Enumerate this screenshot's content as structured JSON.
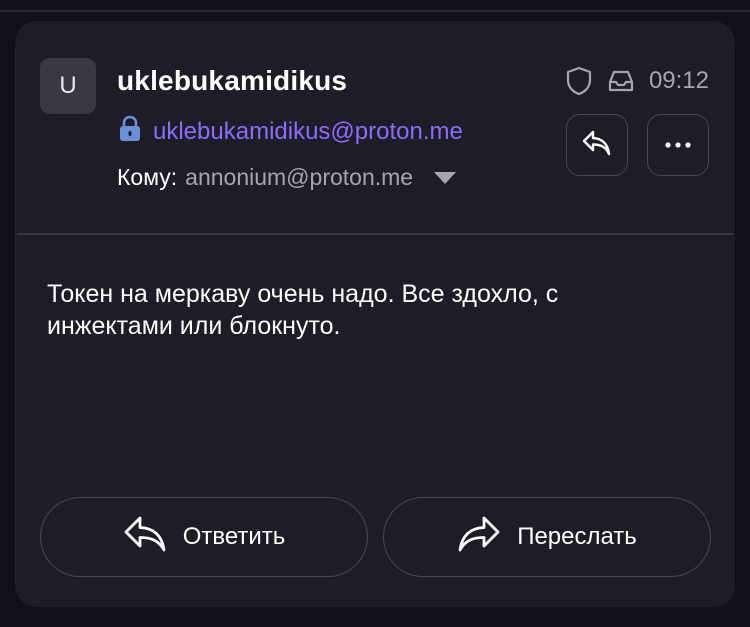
{
  "sender": {
    "avatar_letter": "U",
    "name": "uklebukamidikus",
    "email": "uklebukamidikus@proton.me"
  },
  "header": {
    "time": "09:12",
    "icons": [
      "shield-icon",
      "inbox-icon"
    ]
  },
  "recipients": {
    "label": "Кому:",
    "address": "annonium@proton.me"
  },
  "message": {
    "body": "Токен на меркаву очень надо. Все здохло, с инжектами или блокнуто."
  },
  "actions": {
    "reply_label": "Ответить",
    "forward_label": "Переслать"
  },
  "colors": {
    "background": "#101018",
    "card": "#1e1c26",
    "accent": "#8b6cff",
    "lock": "#6a8fd8",
    "muted": "#a7a4b0"
  }
}
